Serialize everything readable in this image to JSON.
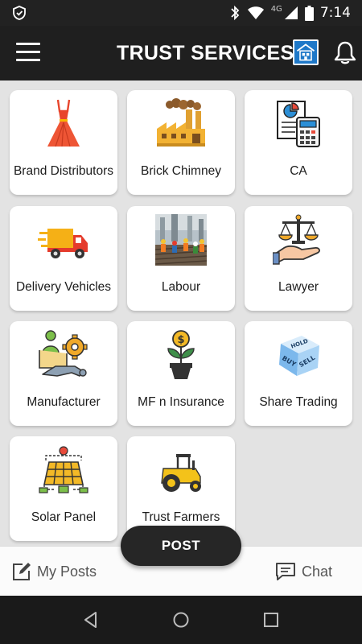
{
  "status_bar": {
    "network": "4G",
    "time": "7:14",
    "icons": [
      "shield-icon",
      "bluetooth-icon",
      "wifi-icon",
      "signal-icon",
      "battery-icon"
    ]
  },
  "header": {
    "title": "TRUST SERVICES",
    "menu_icon": "hamburger-menu-icon",
    "logo_icon": "building-logo-icon",
    "notification_icon": "bell-icon",
    "colors": {
      "background": "#1f1f1f",
      "text": "#ffffff",
      "logo": "#1e78c8"
    }
  },
  "services": [
    {
      "label": "Brand Distributors",
      "icon": "dress-icon"
    },
    {
      "label": "Brick Chimney",
      "icon": "factory-icon"
    },
    {
      "label": "CA",
      "icon": "calculator-document-icon"
    },
    {
      "label": "Delivery Vehicles",
      "icon": "delivery-truck-icon"
    },
    {
      "label": "Labour",
      "icon": "labour-photo"
    },
    {
      "label": "Lawyer",
      "icon": "scales-hand-icon"
    },
    {
      "label": "Manufacturer",
      "icon": "manufacturer-gear-icon"
    },
    {
      "label": "MF n Insurance",
      "icon": "money-plant-icon"
    },
    {
      "label": "Share Trading",
      "icon": "buy-sell-dice-icon"
    },
    {
      "label": "Solar Panel",
      "icon": "solar-panel-icon"
    },
    {
      "label": "Trust Farmers",
      "icon": "tractor-icon"
    }
  ],
  "bottom_bar": {
    "my_posts_label": "My Posts",
    "my_posts_icon": "edit-square-icon",
    "post_button_label": "POST",
    "chat_label": "Chat",
    "chat_icon": "chat-bubble-icon"
  },
  "nav_bar": {
    "icons": [
      "back-triangle-icon",
      "home-circle-icon",
      "recents-square-icon"
    ]
  }
}
